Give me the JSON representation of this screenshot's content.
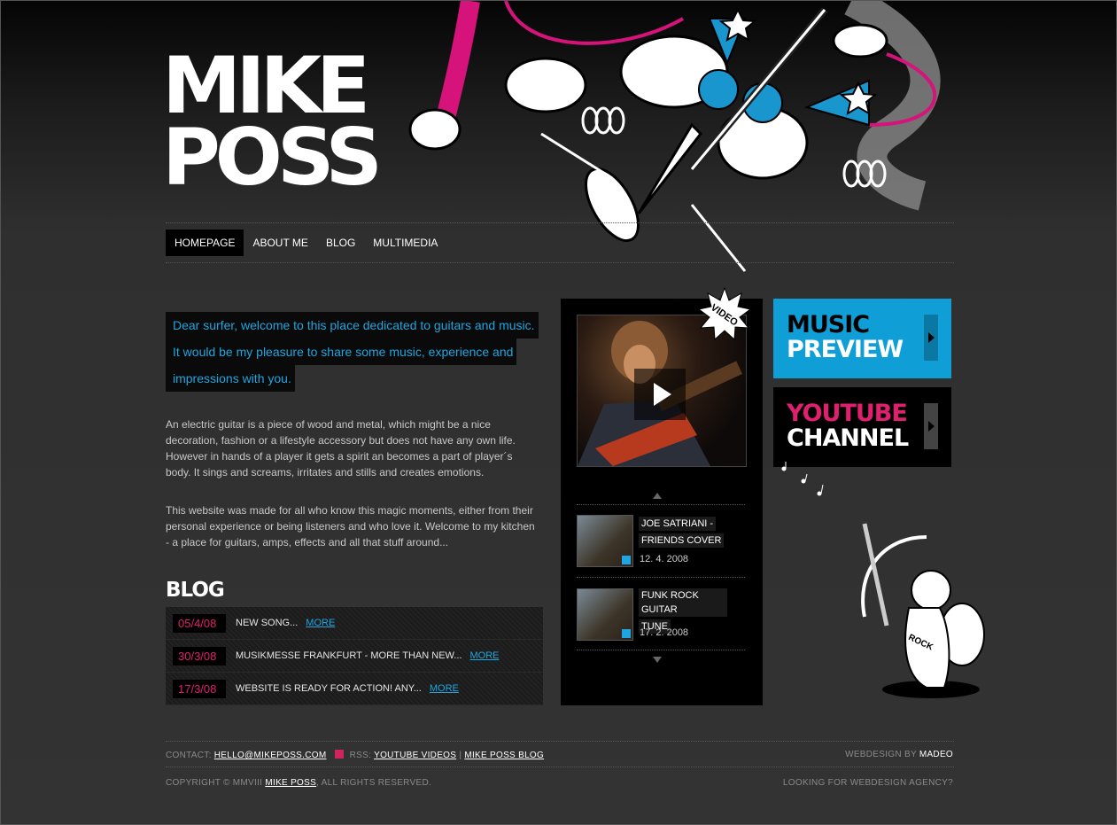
{
  "logo": {
    "line1": "MIKE",
    "line2": "POSS"
  },
  "nav": [
    {
      "label": "HOMEPAGE",
      "active": true
    },
    {
      "label": "ABOUT ME"
    },
    {
      "label": "BLOG"
    },
    {
      "label": "MULTIMEDIA"
    }
  ],
  "intro": {
    "lines": [
      "Dear surfer, welcome to this place dedicated to guitars and music.",
      "It would be my pleasure to share some music, experience and",
      "impressions with you."
    ]
  },
  "paragraphs": [
    "An electric guitar is a piece of wood and metal, which might be a nice decoration, fashion or a lifestyle accessory but does not have any own life. However in hands of a player it gets a spirit an becomes a part of player´s body. It sings and screams, irritates and stills and creates emotions.",
    "This website was made for all who know this magic moments, either from their personal experience or being listeners and who love it. Welcome to my kitchen - a place for guitars, amps, effects and all that stuff around..."
  ],
  "blog": {
    "title": "BLOG",
    "items": [
      {
        "date": "05/4/08",
        "text": "NEW SONG...",
        "more": "MORE"
      },
      {
        "date": "30/3/08",
        "text": "MUSIKMESSE FRANKFURT - MORE THAN NEW...",
        "more": "MORE"
      },
      {
        "date": "17/3/08",
        "text": "WEBSITE IS READY FOR ACTION! ANY...",
        "more": "MORE"
      }
    ]
  },
  "video": {
    "badge": "VIDEO",
    "items": [
      {
        "title_lines": [
          "JOE SATRIANI -",
          "FRIENDS COVER"
        ],
        "date": "12. 4. 2008"
      },
      {
        "title_lines": [
          "FUNK ROCK GUITAR",
          "TUNE"
        ],
        "date": "17. 2. 2008"
      }
    ]
  },
  "promos": {
    "music": {
      "line1": "MUSIC",
      "line2": "PREVIEW"
    },
    "youtube": {
      "line1": "YOUTUBE",
      "line2": "CHANNEL"
    }
  },
  "cupid": {
    "shirt_text": "ROCK"
  },
  "footer": {
    "contact_label": "CONTACT:",
    "contact_email": "HELLO@MIKEPOSS.COM",
    "rss_label": "RSS:",
    "rss_link1": "YOUTUBE VIDEOS",
    "rss_sep": "|",
    "rss_link2": "MIKE POSS BLOG",
    "webdesign_label": "WEBDESIGN BY",
    "webdesign_link": "MADEO",
    "copyright_prefix": "COPYRIGHT © MMVIII",
    "copyright_link": "MIKE POSS",
    "copyright_suffix": ", ALL RIGHTS RESERVED.",
    "agency": "LOOKING FOR WEBDESIGN AGENCY?"
  },
  "colors": {
    "accent_blue": "#1fa6e0",
    "accent_pink": "#e0206f",
    "background": "#2e2e2e"
  }
}
